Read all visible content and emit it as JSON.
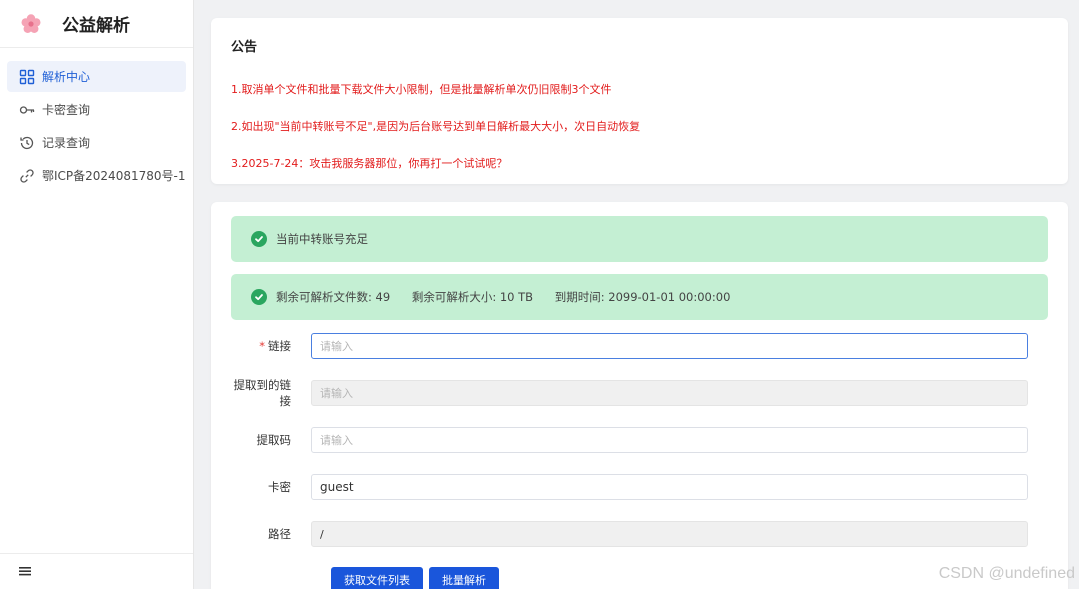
{
  "app": {
    "title": "公益解析"
  },
  "sidebar": {
    "items": [
      {
        "label": "解析中心",
        "icon": "grid-icon",
        "active": true
      },
      {
        "label": "卡密查询",
        "icon": "key-icon"
      },
      {
        "label": "记录查询",
        "icon": "history-icon"
      },
      {
        "label": "鄂ICP备2024081780号-1",
        "icon": "link-icon"
      }
    ],
    "footer_icon": "menu-icon"
  },
  "notice": {
    "title": "公告",
    "lines": [
      "1.取消单个文件和批量下载文件大小限制，但是批量解析单次仍旧限制3个文件",
      "2.如出现\"当前中转账号不足\",是因为后台账号达到单日解析最大大小，次日自动恢复",
      "3.2025-7-24：攻击我服务器那位，你再打一个试试呢？"
    ]
  },
  "status": {
    "account": "当前中转账号充足",
    "remaining_files": "剩余可解析文件数: 49",
    "remaining_size": "剩余可解析大小: 10 TB",
    "expiry": "到期时间: 2099-01-01 00:00:00"
  },
  "form": {
    "link": {
      "label": "链接",
      "placeholder": "请输入",
      "value": ""
    },
    "extracted": {
      "label": "提取到的链接",
      "placeholder": "请输入",
      "value": ""
    },
    "code": {
      "label": "提取码",
      "placeholder": "请输入",
      "value": ""
    },
    "card": {
      "label": "卡密",
      "value": "guest"
    },
    "path": {
      "label": "路径",
      "value": "/"
    }
  },
  "buttons": {
    "get_list": "获取文件列表",
    "batch_parse": "批量解析"
  },
  "watermark": "CSDN @undefined",
  "colors": {
    "accent": "#1a56db",
    "notice_text": "#e21b1b",
    "success_bg": "#c4efd3",
    "success_icon": "#2aa65f"
  }
}
